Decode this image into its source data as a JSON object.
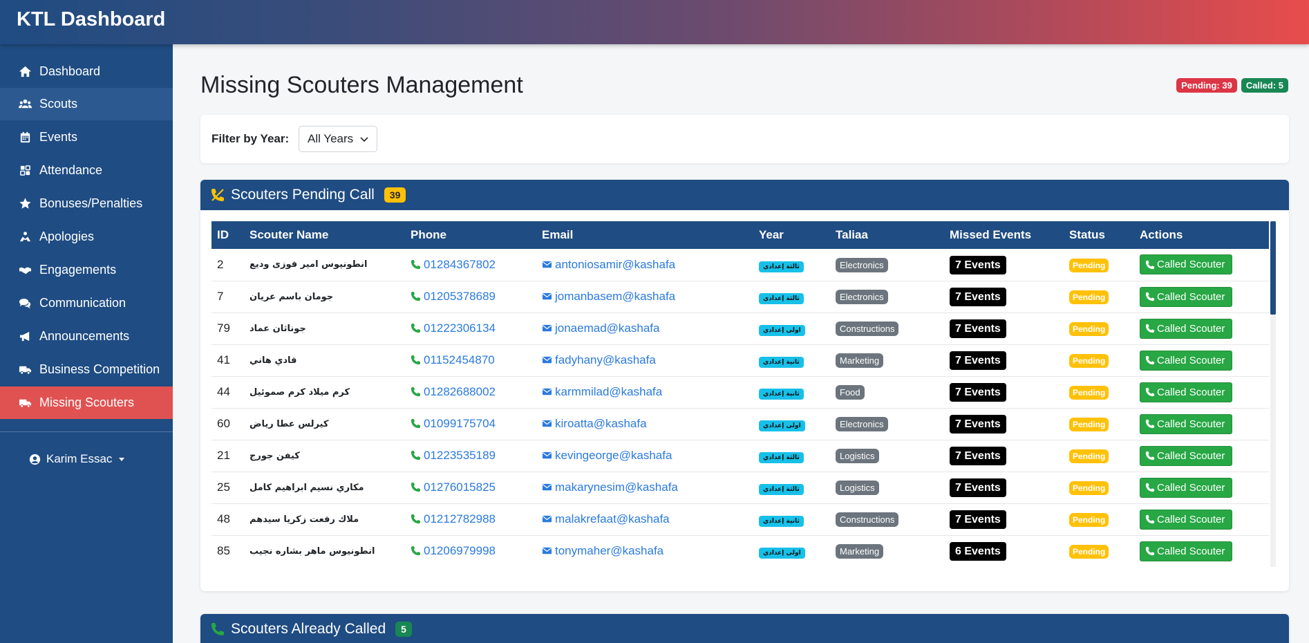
{
  "app": {
    "title": "KTL Dashboard"
  },
  "sidebar": {
    "items": [
      {
        "label": "Dashboard",
        "icon": "home-icon"
      },
      {
        "label": "Scouts",
        "icon": "users-icon"
      },
      {
        "label": "Events",
        "icon": "calendar-icon"
      },
      {
        "label": "Attendance",
        "icon": "grid-icon"
      },
      {
        "label": "Bonuses/Penalties",
        "icon": "star-icon"
      },
      {
        "label": "Apologies",
        "icon": "hands-icon"
      },
      {
        "label": "Engagements",
        "icon": "handshake-icon"
      },
      {
        "label": "Communication",
        "icon": "comments-icon"
      },
      {
        "label": "Announcements",
        "icon": "bullhorn-icon"
      },
      {
        "label": "Business Competition",
        "icon": "truck-icon"
      },
      {
        "label": "Missing Scouters",
        "icon": "truck-icon"
      }
    ],
    "active": "Missing Scouters",
    "user": "Karim Essac"
  },
  "page": {
    "title": "Missing Scouters Management",
    "pending_badge": "Pending: 39",
    "called_badge": "Called: 5"
  },
  "filter": {
    "label": "Filter by Year:",
    "selected": "All Years"
  },
  "pending_section": {
    "title": "Scouters Pending Call",
    "count": "39",
    "columns": [
      "ID",
      "Scouter Name",
      "Phone",
      "Email",
      "Year",
      "Taliaa",
      "Missed Events",
      "Status",
      "Actions"
    ],
    "rows": [
      {
        "id": "2",
        "name": "انطونيوس امير فوزى وديع",
        "phone": "01284367802",
        "email": "antoniosamir@kashafa",
        "year": "ثالثة إعدادي",
        "taliaa": "Electronics",
        "missed": "7 Events",
        "status": "Pending",
        "action": "Called Scouter"
      },
      {
        "id": "7",
        "name": "جومان باسم عريان",
        "phone": "01205378689",
        "email": "jomanbasem@kashafa",
        "year": "ثالثة إعدادي",
        "taliaa": "Electronics",
        "missed": "7 Events",
        "status": "Pending",
        "action": "Called Scouter"
      },
      {
        "id": "79",
        "name": "جوناثان عماد",
        "phone": "01222306134",
        "email": "jonaemad@kashafa",
        "year": "اولى إعدادي",
        "taliaa": "Constructions",
        "missed": "7 Events",
        "status": "Pending",
        "action": "Called Scouter"
      },
      {
        "id": "41",
        "name": "فادي هاني",
        "phone": "01152454870",
        "email": "fadyhany@kashafa",
        "year": "ثانية إعدادي",
        "taliaa": "Marketing",
        "missed": "7 Events",
        "status": "Pending",
        "action": "Called Scouter"
      },
      {
        "id": "44",
        "name": "كرم ميلاد كرم صموئيل",
        "phone": "01282688002",
        "email": "karmmilad@kashafa",
        "year": "ثانية إعدادي",
        "taliaa": "Food",
        "missed": "7 Events",
        "status": "Pending",
        "action": "Called Scouter"
      },
      {
        "id": "60",
        "name": "كيرلس عطا رياض",
        "phone": "01099175704",
        "email": "kiroatta@kashafa",
        "year": "اولى إعدادي",
        "taliaa": "Electronics",
        "missed": "7 Events",
        "status": "Pending",
        "action": "Called Scouter"
      },
      {
        "id": "21",
        "name": "كيفن جورج",
        "phone": "01223535189",
        "email": "kevingeorge@kashafa",
        "year": "ثالثة إعدادي",
        "taliaa": "Logistics",
        "missed": "7 Events",
        "status": "Pending",
        "action": "Called Scouter"
      },
      {
        "id": "25",
        "name": "مكاري نسيم ابراهيم كامل",
        "phone": "01276015825",
        "email": "makarynesim@kashafa",
        "year": "ثالثة إعدادي",
        "taliaa": "Logistics",
        "missed": "7 Events",
        "status": "Pending",
        "action": "Called Scouter"
      },
      {
        "id": "48",
        "name": "ملاك رفعت زكريا سيدهم",
        "phone": "01212782988",
        "email": "malakrefaat@kashafa",
        "year": "ثانية إعدادي",
        "taliaa": "Constructions",
        "missed": "7 Events",
        "status": "Pending",
        "action": "Called Scouter"
      },
      {
        "id": "85",
        "name": "انطونيوس ماهر بشاره نجيب",
        "phone": "01206979998",
        "email": "tonymaher@kashafa",
        "year": "اولى إعدادي",
        "taliaa": "Marketing",
        "missed": "6 Events",
        "status": "Pending",
        "action": "Called Scouter"
      }
    ]
  },
  "called_section": {
    "title": "Scouters Already Called",
    "count": "5"
  },
  "colors": {
    "primary": "#1f4c82",
    "active": "#e05252",
    "link": "#2a7ade",
    "success": "#28a745",
    "warning": "#ffc107",
    "info": "#17c0e8"
  }
}
